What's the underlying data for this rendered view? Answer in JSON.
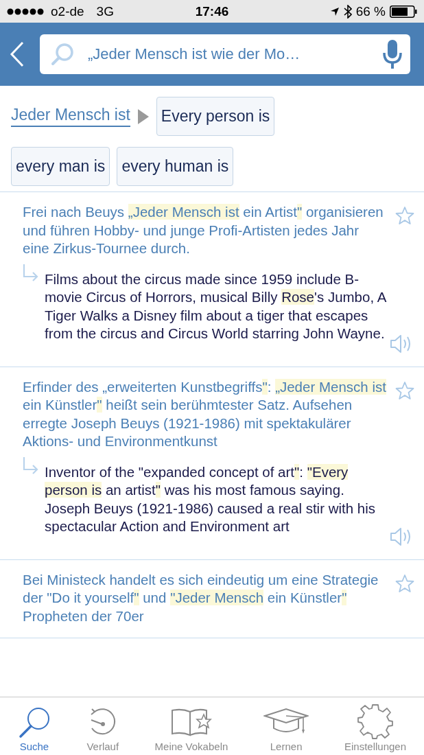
{
  "status_bar": {
    "carrier": "o2-de",
    "network": "3G",
    "time": "17:46",
    "battery": "66 %"
  },
  "search": {
    "value": "„Jeder Mensch ist wie der Mo…"
  },
  "phrase": {
    "source": "Jeder Mensch ist",
    "translations": [
      "Every person is",
      "every man is",
      "every human is"
    ]
  },
  "entries": [
    {
      "de": [
        {
          "text": "Frei nach Beuys ",
          "highlighted": false
        },
        {
          "text": "„Jeder Mensch ist",
          "highlighted": true
        },
        {
          "text": " ein Artist",
          "highlighted": false
        },
        {
          "text": "\"",
          "highlighted": true
        },
        {
          "text": " organisieren und führen Hobby- und junge Profi-Artisten jedes Jahr eine Zirkus-Tournee durch.",
          "highlighted": false
        }
      ],
      "en": [
        {
          "text": "Films about the circus made since 1959 include B-movie Circus of Horrors, musical Billy ",
          "highlighted": false
        },
        {
          "text": "Rose",
          "highlighted": true
        },
        {
          "text": "'s Jumbo, A Tiger Walks a Disney film about a tiger that escapes from the circus and Circus World starring John Wayne.",
          "highlighted": false
        }
      ]
    },
    {
      "de": [
        {
          "text": "Erfinder des „erweiterten Kunstbegriffs",
          "highlighted": false
        },
        {
          "text": "\"",
          "highlighted": true
        },
        {
          "text": ": ",
          "highlighted": false
        },
        {
          "text": "„Jeder Mensch ist",
          "highlighted": true
        },
        {
          "text": " ein Künstler",
          "highlighted": false
        },
        {
          "text": "\"",
          "highlighted": true
        },
        {
          "text": " heißt sein berühmtester Satz. Aufsehen erregte Joseph Beuys (1921-1986) mit spektakulärer Aktions- und Environmentkunst",
          "highlighted": false
        }
      ],
      "en": [
        {
          "text": "Inventor of the \"expanded concept of art",
          "highlighted": false
        },
        {
          "text": "\"",
          "highlighted": true
        },
        {
          "text": ": ",
          "highlighted": false
        },
        {
          "text": "\"Every person is",
          "highlighted": true
        },
        {
          "text": " an artist",
          "highlighted": false
        },
        {
          "text": "\"",
          "highlighted": true
        },
        {
          "text": " was his most famous saying. Joseph Beuys (1921-1986) caused a real stir with his spectacular Action and Environment art",
          "highlighted": false
        }
      ]
    },
    {
      "de": [
        {
          "text": "Bei Ministeck handelt es sich eindeutig um eine Strategie der \"Do it yourself",
          "highlighted": false
        },
        {
          "text": "\"",
          "highlighted": true
        },
        {
          "text": " und ",
          "highlighted": false
        },
        {
          "text": "\"Jeder Mensch",
          "highlighted": true
        },
        {
          "text": " ein Künstler",
          "highlighted": false
        },
        {
          "text": "\"",
          "highlighted": true
        },
        {
          "text": " Propheten der 70er",
          "highlighted": false
        }
      ]
    }
  ],
  "tabs": [
    {
      "label": "Suche",
      "kind": "search",
      "selected": true
    },
    {
      "label": "Verlauf",
      "kind": "history",
      "selected": false
    },
    {
      "label": "Meine Vokabeln",
      "kind": "vocabulary",
      "selected": false
    },
    {
      "label": "Lernen",
      "kind": "learn",
      "selected": false
    },
    {
      "label": "Einstellungen",
      "kind": "settings",
      "selected": false
    }
  ]
}
